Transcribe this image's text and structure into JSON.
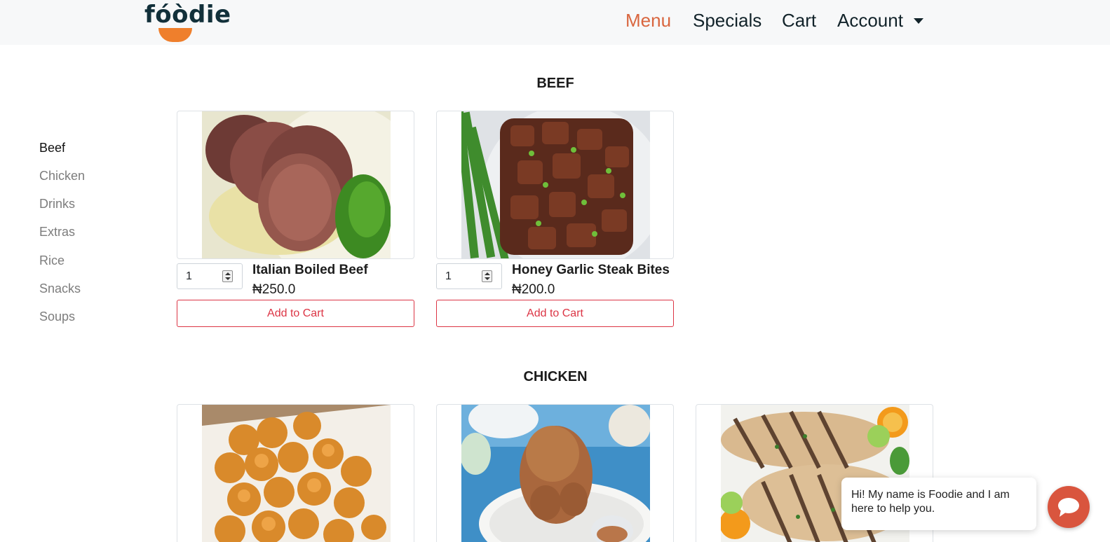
{
  "header": {
    "logo_text": "fóòdie",
    "nav": {
      "menu": "Menu",
      "specials": "Specials",
      "cart": "Cart",
      "account": "Account"
    },
    "active_color": "#d9663f"
  },
  "sidebar": {
    "items": [
      {
        "label": "Beef"
      },
      {
        "label": "Chicken"
      },
      {
        "label": "Drinks"
      },
      {
        "label": "Extras"
      },
      {
        "label": "Rice"
      },
      {
        "label": "Snacks"
      },
      {
        "label": "Soups"
      }
    ],
    "active": "Beef"
  },
  "sections": [
    {
      "title": "BEEF",
      "items": [
        {
          "name": "Italian Boiled Beef",
          "price": "₦250.0",
          "quantity": "1",
          "button": "Add to Cart"
        },
        {
          "name": "Honey Garlic Steak Bites",
          "price": "₦200.0",
          "quantity": "1",
          "button": "Add to Cart"
        }
      ]
    },
    {
      "title": "CHICKEN",
      "items": [
        {
          "image": "chicken-nuggets"
        },
        {
          "image": "roast-chicken"
        },
        {
          "image": "grilled-chicken-breast"
        }
      ]
    }
  ],
  "chat": {
    "message": "Hi! My name is Foodie and I am here to help you.",
    "icon": "chat-icon"
  },
  "colors": {
    "accent": "#dc3545",
    "chat_button": "#d9553e",
    "logo_smile": "#ef7f2c"
  }
}
